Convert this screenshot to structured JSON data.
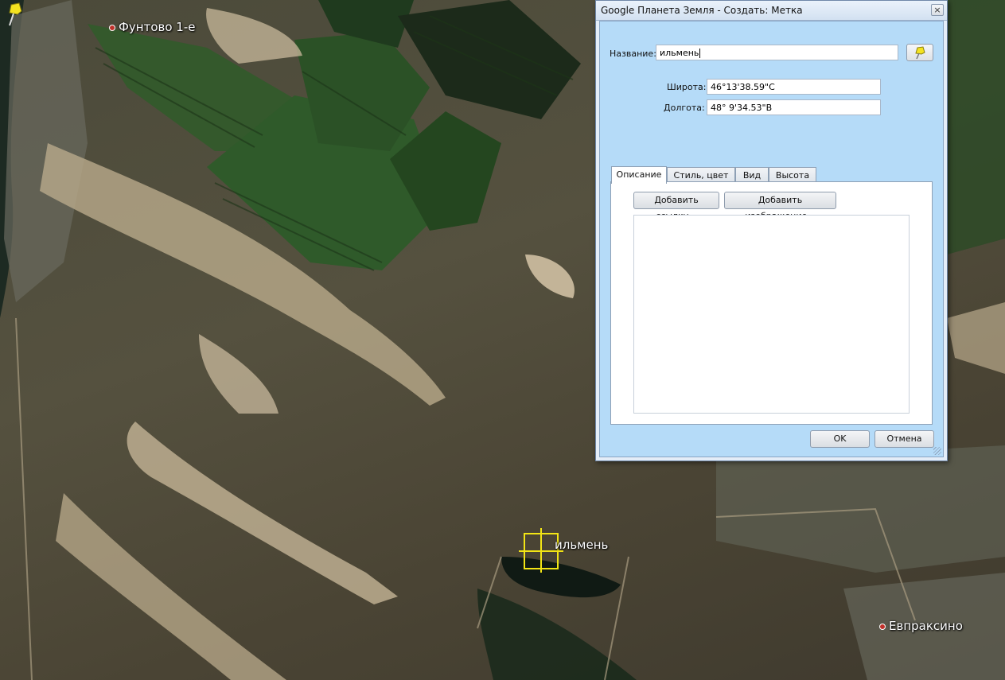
{
  "map": {
    "places": [
      {
        "name": "Фунтово 1-е"
      },
      {
        "name": "Евпраксино"
      }
    ],
    "placemark_label": "ильмень",
    "colors": {
      "field_green": "#2f5a2a",
      "dark_green": "#1f3a1e",
      "sand": "#b8a98a",
      "water": "#142018",
      "pin": "#f2e515"
    }
  },
  "dialog": {
    "title": "Google Планета Земля - Создать: Метка",
    "close_icon": "close-icon",
    "name_label": "Название:",
    "name_value": "ильмень",
    "pin_icon": "yellow-pushpin-icon",
    "lat_label": "Широта:",
    "lat_value": "46°13'38.59\"С",
    "lon_label": "Долгота:",
    "lon_value": "48° 9'34.53\"В",
    "tabs": [
      {
        "label": "Описание",
        "active": true
      },
      {
        "label": "Стиль, цвет",
        "active": false
      },
      {
        "label": "Вид",
        "active": false
      },
      {
        "label": "Высота",
        "active": false
      }
    ],
    "add_link_label": "Добавить ссылку...",
    "add_image_label": "Добавить изображение...",
    "description_value": "",
    "ok_label": "OK",
    "cancel_label": "Отмена"
  }
}
